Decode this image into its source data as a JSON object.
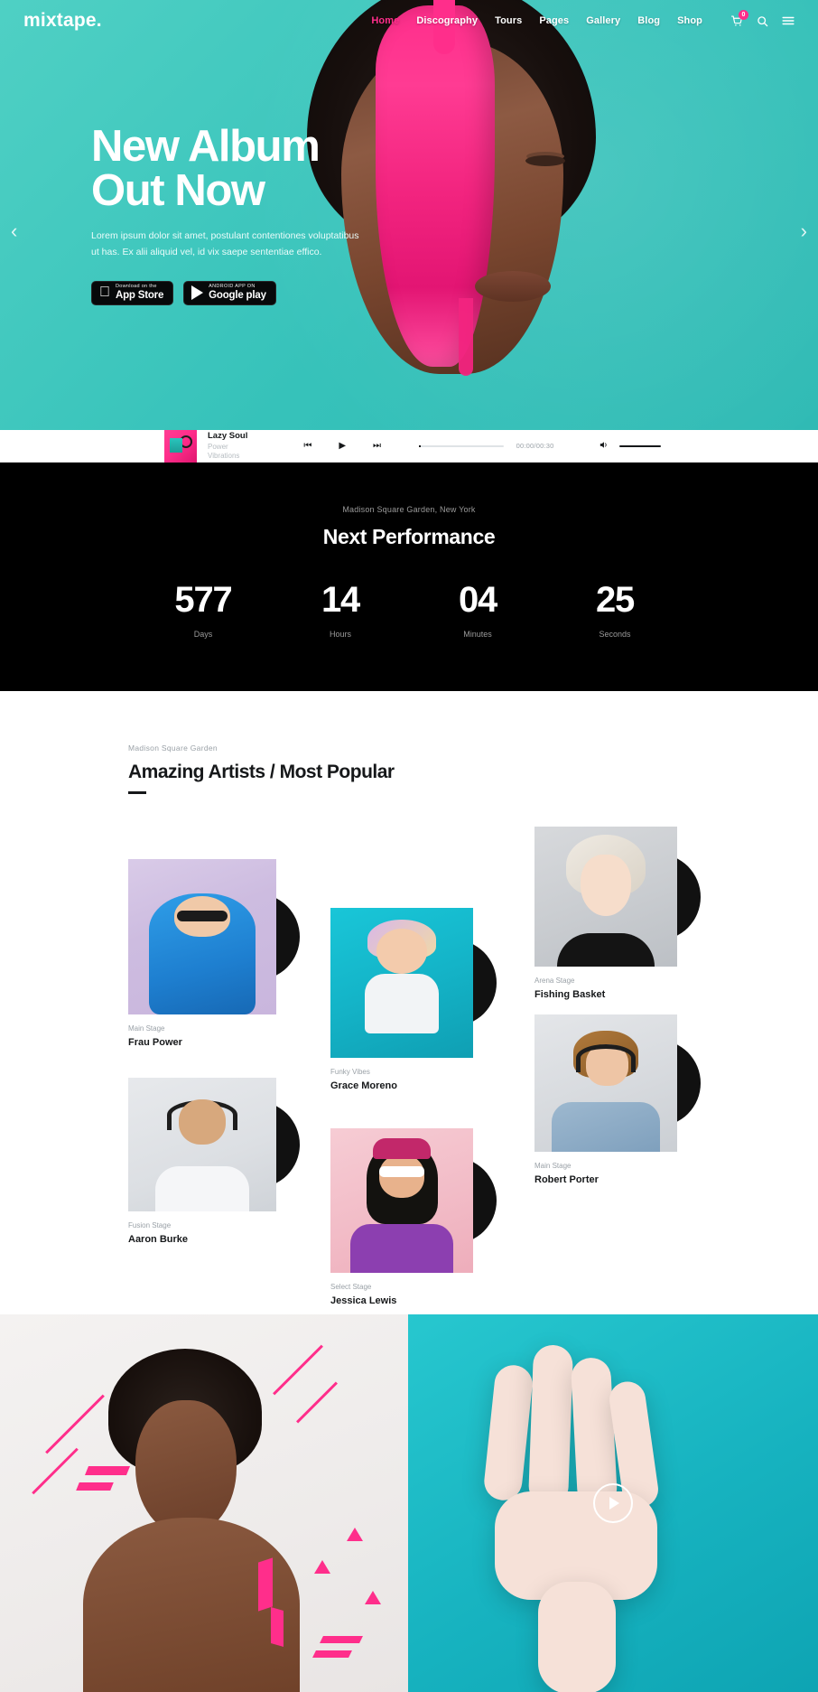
{
  "brand": "mixtape.",
  "nav": {
    "links": [
      {
        "label": "Home",
        "active": true
      },
      {
        "label": "Discography",
        "active": false
      },
      {
        "label": "Tours",
        "active": false
      },
      {
        "label": "Pages",
        "active": false
      },
      {
        "label": "Gallery",
        "active": false
      },
      {
        "label": "Blog",
        "active": false
      },
      {
        "label": "Shop",
        "active": false
      }
    ],
    "cart_count": "0",
    "icons": [
      "cart-icon",
      "search-icon",
      "menu-icon"
    ]
  },
  "hero": {
    "title_line1": "New Album",
    "title_line2": "Out Now",
    "paragraph_line1": "Lorem ipsum dolor sit amet, postulant contentiones voluptatibus ut has.",
    "paragraph_line2": "Ex alii aliquid vel, id vix saepe sententiae effico.",
    "app_store": {
      "small": "Download on the",
      "big": "App Store"
    },
    "google_play": {
      "small": "ANDROID APP ON",
      "big": "Google play"
    },
    "prev_arrow": "‹",
    "next_arrow": "›",
    "accent": "#41c9bf"
  },
  "player": {
    "track_title": "Lazy Soul",
    "track_artist": "Power Vibrations",
    "prev": "⏮",
    "play": "▶",
    "next": "⏭",
    "time": "00:00/00:30",
    "volume_icon": "🔊"
  },
  "countdown": {
    "venue": "Madison Square Garden, New York",
    "title": "Next Performance",
    "units": [
      {
        "value": "577",
        "label": "Days"
      },
      {
        "value": "14",
        "label": "Hours"
      },
      {
        "value": "04",
        "label": "Minutes"
      },
      {
        "value": "25",
        "label": "Seconds"
      }
    ]
  },
  "artists_section": {
    "kicker": "Madison Square Garden",
    "title": "Amazing Artists / Most Popular",
    "cards": [
      {
        "stage": "Main Stage",
        "name": "Frau Power"
      },
      {
        "stage": "Funky Vibes",
        "name": "Grace Moreno"
      },
      {
        "stage": "Arena Stage",
        "name": "Fishing Basket"
      },
      {
        "stage": "Fusion Stage",
        "name": "Aaron Burke"
      },
      {
        "stage": "Select Stage",
        "name": "Jessica Lewis"
      },
      {
        "stage": "Main Stage",
        "name": "Robert Porter"
      }
    ]
  },
  "bottom": {
    "play_button_label": "play-video"
  }
}
